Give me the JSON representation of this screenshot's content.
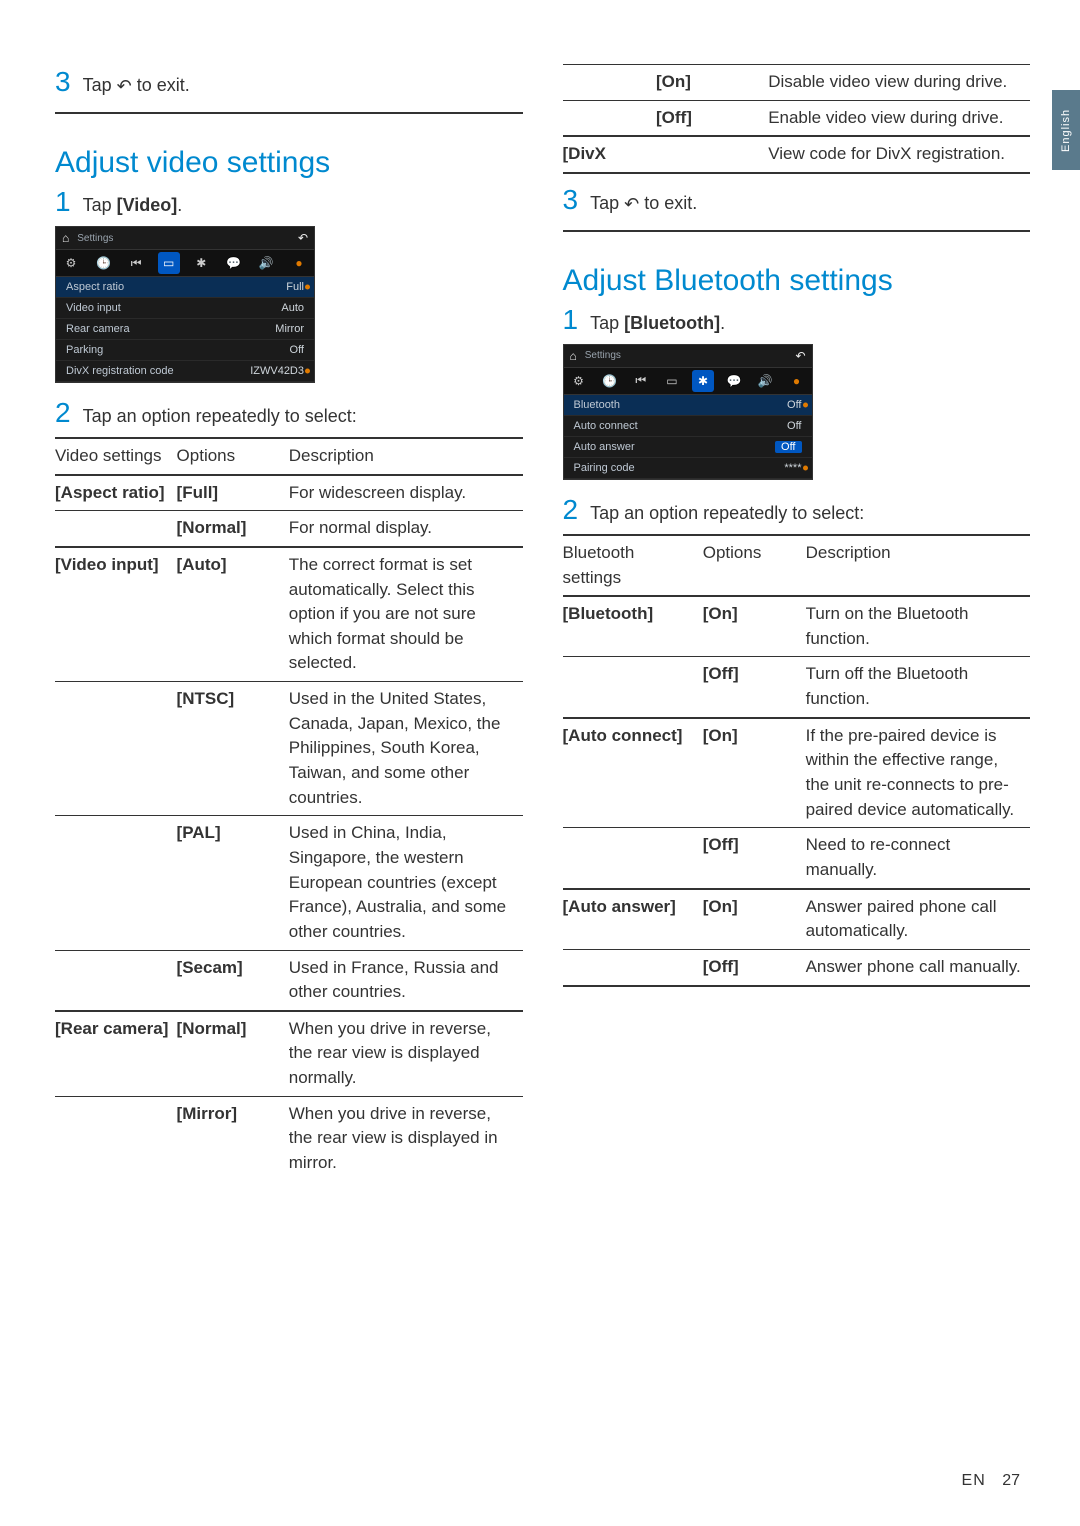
{
  "side_tab": "English",
  "footer": {
    "lang": "EN",
    "page": "27"
  },
  "left": {
    "step3": {
      "num": "3",
      "text_before": "Tap ",
      "text_after": " to exit."
    },
    "heading": "Adjust video settings",
    "step1": {
      "num": "1",
      "text_before": "Tap ",
      "bold": "[Video]",
      "text_after": "."
    },
    "shot": {
      "home_label": "Settings",
      "rows": [
        {
          "label": "Aspect ratio",
          "value": "Full",
          "sel": true
        },
        {
          "label": "Video input",
          "value": "Auto"
        },
        {
          "label": "Rear camera",
          "value": "Mirror"
        },
        {
          "label": "Parking",
          "value": "Off"
        },
        {
          "label": "DivX registration code",
          "value": "IZWV42D3"
        }
      ]
    },
    "step2": {
      "num": "2",
      "text": "Tap an option repeatedly to select:"
    },
    "table": {
      "head": [
        "Video settings",
        "Options",
        "Description"
      ],
      "rows": [
        {
          "setting": "[Aspect ratio]",
          "option": "[Full]",
          "desc": "For widescreen display.",
          "heavy": true
        },
        {
          "setting": "",
          "option": "[Normal]",
          "desc": "For normal display.",
          "rule": true
        },
        {
          "setting": "[Video input]",
          "option": "[Auto]",
          "desc": "The correct format is set automatically. Select this option if you are not sure which format should be selected.",
          "heavy": true
        },
        {
          "setting": "",
          "option": "[NTSC]",
          "desc": "Used in the United States, Canada, Japan, Mexico, the Philippines, South Korea, Taiwan, and some other countries.",
          "rule": true
        },
        {
          "setting": "",
          "option": "[PAL]",
          "desc": "Used in China, India, Singapore, the western European countries (except France), Australia, and some other countries.",
          "rule": true
        },
        {
          "setting": "",
          "option": "[Secam]",
          "desc": "Used in France, Russia and other countries.",
          "rule": true
        },
        {
          "setting": "[Rear camera]",
          "option": "[Normal]",
          "desc": "When you drive in reverse, the rear view is displayed normally.",
          "heavy": true
        },
        {
          "setting": "",
          "option": "[Mirror]",
          "desc": "When you drive in reverse, the rear view is displayed in mirror.",
          "rule": true
        }
      ]
    }
  },
  "right": {
    "cont_rows": [
      {
        "setting": "",
        "option": "[On]",
        "desc": "Disable video view during drive.",
        "rule": true
      },
      {
        "setting": "",
        "option": "[Off]",
        "desc": "Enable video view during drive.",
        "rule": true
      },
      {
        "setting": "[DivX",
        "option": "",
        "desc": "View code for DivX registration.",
        "heavy": true,
        "last": true
      }
    ],
    "step3": {
      "num": "3",
      "text_before": "Tap ",
      "text_after": " to exit."
    },
    "heading": "Adjust Bluetooth settings",
    "step1": {
      "num": "1",
      "text_before": "Tap ",
      "bold": "[Bluetooth]",
      "text_after": "."
    },
    "shot": {
      "home_label": "Settings",
      "rows": [
        {
          "label": "Bluetooth",
          "value": "Off",
          "sel": true
        },
        {
          "label": "Auto connect",
          "value": "Off"
        },
        {
          "label": "Auto answer",
          "value": "Off",
          "valsel": true
        },
        {
          "label": "Pairing code",
          "value": "****"
        }
      ]
    },
    "step2": {
      "num": "2",
      "text": "Tap an option repeatedly to select:"
    },
    "table": {
      "head": [
        "Bluetooth settings",
        "Options",
        "Description"
      ],
      "rows": [
        {
          "setting": "[Bluetooth]",
          "option": "[On]",
          "desc": "Turn on the Bluetooth function.",
          "heavy": true
        },
        {
          "setting": "",
          "option": "[Off]",
          "desc": "Turn off the Bluetooth function.",
          "rule": true
        },
        {
          "setting": "[Auto connect]",
          "option": "[On]",
          "desc": "If the pre-paired device is within the effective range, the unit re-connects to pre-paired device automatically.",
          "heavy": true
        },
        {
          "setting": "",
          "option": "[Off]",
          "desc": "Need to re-connect manually.",
          "rule": true
        },
        {
          "setting": "[Auto answer]",
          "option": "[On]",
          "desc": "Answer paired phone call automatically.",
          "heavy": true
        },
        {
          "setting": "",
          "option": "[Off]",
          "desc": "Answer phone call manually.",
          "rule": true,
          "last": true
        }
      ]
    }
  }
}
